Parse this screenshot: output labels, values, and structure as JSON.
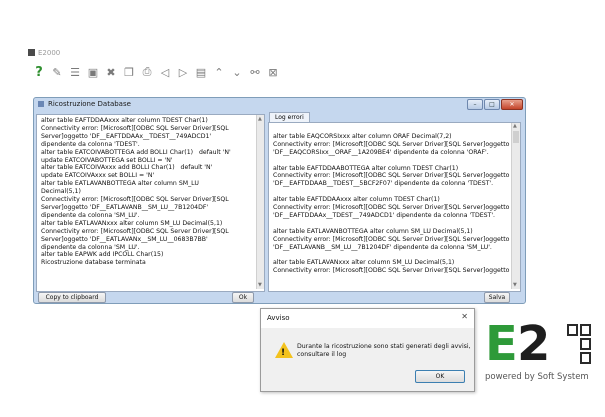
{
  "app": {
    "title": "E2000"
  },
  "dialog": {
    "title": "Ricostruzione Database",
    "left_lines": [
      "alter table EAFTDDAAxxx alter column TDEST Char(1)",
      "Connectivity error: [Microsoft][ODBC SQL Server Driver][SQL",
      "Server]oggetto 'DF__EAFTDDAAx__TDEST__749ADCD1'",
      "dipendente da colonna 'TDEST'.",
      "alter table EATCOIVABOTTEGA add BOLLI Char(1)   default 'N'",
      "update EATCOIVABOTTEGA set BOLLI = 'N'",
      "alter table EATCOIVAxxx add BOLLI Char(1)   default 'N'",
      "update EATCOIVAxxx set BOLLI = 'N'",
      "alter table EATLAVANBOTTEGA alter column SM_LU",
      "Decimal(5,1)",
      "Connectivity error: [Microsoft][ODBC SQL Server Driver][SQL",
      "Server]oggetto 'DF__EATLAVANB__SM_LU__7B1204DF'",
      "dipendente da colonna 'SM_LU'.",
      "alter table EATLAVANxxx alter column SM_LU Decimal(5,1)",
      "Connectivity error: [Microsoft][ODBC SQL Server Driver][SQL",
      "Server]oggetto 'DF__EATLAVANx__SM_LU__0683B7BB'",
      "dipendente da colonna 'SM_LU'.",
      "alter table EAPWK add IPCOLL Char(15)",
      "Ricostruzione database terminata"
    ],
    "log_tab": "Log errori",
    "right_lines": [
      "",
      "alter table EAQCORSIxxx alter column ORAF Decimal(7,2)",
      "Connectivity error: [Microsoft][ODBC SQL Server Driver][SQL Server]oggetto",
      "'DF__EAQCORSIxx__ORAF__1A209BE4' dipendente da colonna 'ORAF'.",
      "",
      "alter table EAFTDDAABOTTEGA alter column TDEST Char(1)",
      "Connectivity error: [Microsoft][ODBC SQL Server Driver][SQL Server]oggetto",
      "'DF__EAFTDDAAB__TDEST__5BCF2F07' dipendente da colonna 'TDEST'.",
      "",
      "alter table EAFTDDAAxxx alter column TDEST Char(1)",
      "Connectivity error: [Microsoft][ODBC SQL Server Driver][SQL Server]oggetto",
      "'DF__EAFTDDAAx__TDEST__749ADCD1' dipendente da colonna 'TDEST'.",
      "",
      "alter table EATLAVANBOTTEGA alter column SM_LU Decimal(5,1)",
      "Connectivity error: [Microsoft][ODBC SQL Server Driver][SQL Server]oggetto",
      "'DF__EATLAVANB__SM_LU__7B1204DF' dipendente da colonna 'SM_LU'.",
      "",
      "alter table EATLAVANxxx alter column SM_LU Decimal(5,1)",
      "Connectivity error: [Microsoft][ODBC SQL Server Driver][SQL Server]oggetto"
    ],
    "copy_button": "Copy to clipboard",
    "ok_button": "Ok",
    "save_button": "Salva"
  },
  "alert": {
    "title": "Avviso",
    "close": "✕",
    "message_line1": "Durante la ricostruzione sono stati generati degli avvisi,",
    "message_line2": "consultare il log",
    "ok_button": "OK"
  },
  "logo": {
    "tagline": "powered by Soft System",
    "green": "#2e9a39"
  }
}
